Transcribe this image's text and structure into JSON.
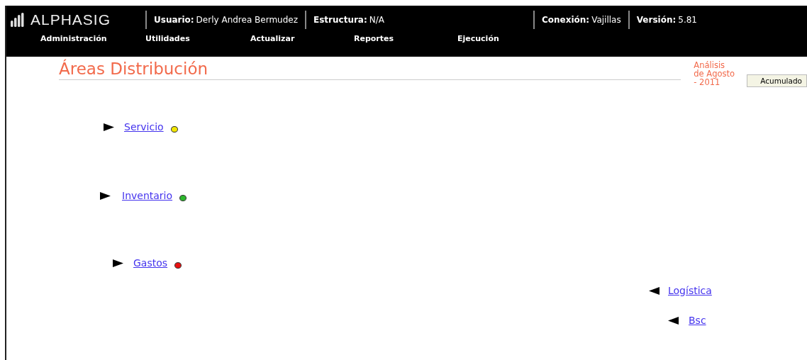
{
  "header": {
    "logo": "ALPHASIG",
    "fields": [
      {
        "label": "Usuario:",
        "value": "Derly Andrea Bermudez"
      },
      {
        "label": "Estructura:",
        "value": "N/A"
      },
      {
        "label": "Conexión:",
        "value": "Vajillas"
      },
      {
        "label": "Versión:",
        "value": "5.81"
      }
    ]
  },
  "menu": [
    "Administración",
    "Utilidades",
    "Actualizar",
    "Reportes",
    "Ejecución"
  ],
  "page": {
    "title": "Áreas Distribución",
    "period": "Análisis de Agosto - 2011",
    "button": "Acumulado"
  },
  "areas": [
    {
      "label": "Servicio",
      "kind": "right",
      "color": "#f2e600"
    },
    {
      "label": "Inventario",
      "kind": "right",
      "color": "#2db82d"
    },
    {
      "label": "Gastos",
      "kind": "right",
      "color": "#e81010"
    },
    {
      "label": "Logística",
      "kind": "left"
    },
    {
      "label": "Bsc",
      "kind": "left"
    }
  ]
}
